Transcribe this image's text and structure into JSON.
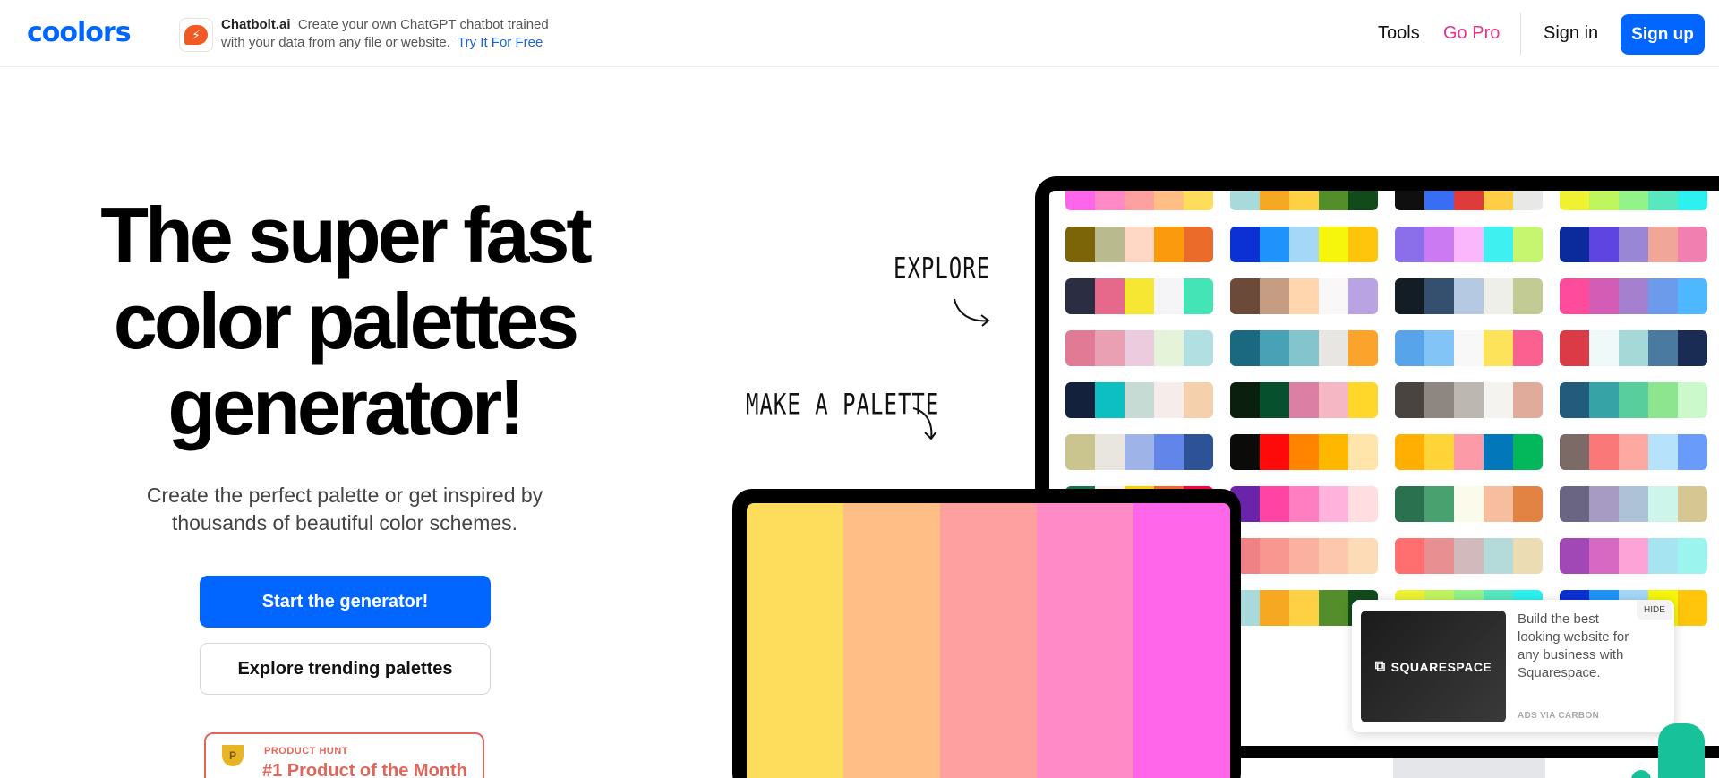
{
  "header": {
    "logo": "coolors",
    "ad": {
      "brand": "Chatbolt.ai",
      "line1": "Create your own ChatGPT chatbot trained",
      "line2": "with your data from any file or website.",
      "cta": "Try It For Free",
      "icon": "chat-bubble-icon"
    },
    "nav": {
      "tools": "Tools",
      "go_pro": "Go Pro",
      "sign_in": "Sign in",
      "sign_up": "Sign up"
    }
  },
  "hero": {
    "title_line1": "The super fast",
    "title_line2": "color palettes",
    "title_line3": "generator!",
    "subtitle_line1": "Create the perfect palette or get inspired by",
    "subtitle_line2": "thousands of beautiful color schemes.",
    "primary_button": "Start the generator!",
    "secondary_button": "Explore trending palettes",
    "badge_label": "PRODUCT HUNT",
    "badge_title": "#1 Product of the Month",
    "badge_icon": "trophy-icon"
  },
  "labels": {
    "explore": "EXPLORE",
    "make_palette": "MAKE A PALETTE"
  },
  "carbon_ad": {
    "image_text": "SQUARESPACE",
    "text": "Build the best looking website for any business with Squarespace.",
    "via": "ADS VIA CARBON",
    "hide": "HIDE"
  },
  "colors": {
    "accent": "#0066ff",
    "go_pro": "#e6348a",
    "badge": "#e0655a"
  },
  "small_palette": [
    "#ffdd5c",
    "#ffbe85",
    "#ffa0a0",
    "#ff8ac6",
    "#ff66ea"
  ],
  "palettes": [
    [
      "#ff66ea",
      "#ff8ac6",
      "#ffa0a0",
      "#ffbe85",
      "#ffdd5c"
    ],
    [
      "#a8dadc",
      "#f7a823",
      "#fed144",
      "#538e2b",
      "#114b1c"
    ],
    [
      "#0f0f0f",
      "#3a6cf4",
      "#e03b3b",
      "#ffce44",
      "#e8e8e6"
    ],
    [
      "#eff233",
      "#c1f55d",
      "#93f28a",
      "#57e8bf",
      "#2cf1ee"
    ],
    [
      "#7b6508",
      "#b9bb8e",
      "#fed8c5",
      "#fc9a0e",
      "#ea6b2a"
    ],
    [
      "#0b31d4",
      "#1f93fb",
      "#a5d8f7",
      "#f6f60c",
      "#ffc50d"
    ],
    [
      "#8a6eea",
      "#cb7af2",
      "#fbb7fb",
      "#3ef0f0",
      "#c6f56f"
    ],
    [
      "#0b2a9c",
      "#5e44e0",
      "#9987d6",
      "#f0a79a",
      "#f17fb0"
    ],
    [
      "#2b2d42",
      "#e6698c",
      "#f6e733",
      "#f5f5f7",
      "#43e4b6"
    ],
    [
      "#6b4a3a",
      "#c49d82",
      "#ffd6ad",
      "#f9f7f7",
      "#b9a3e3"
    ],
    [
      "#121d25",
      "#34506e",
      "#b6c9e2",
      "#edefe8",
      "#c1cb93"
    ],
    [
      "#fe4b9b",
      "#d35db4",
      "#a580cf",
      "#6c9bec",
      "#4db7ff"
    ],
    [
      "#e07a95",
      "#e9a0b2",
      "#eccbde",
      "#e5f3d8",
      "#b1dfe2"
    ],
    [
      "#1b6981",
      "#48a2b5",
      "#84c4cd",
      "#e8e6e3",
      "#fca32c"
    ],
    [
      "#58a4ea",
      "#82c4f5",
      "#f8f8f8",
      "#fde35a",
      "#fb6190"
    ],
    [
      "#da3b47",
      "#effaf8",
      "#a4d9d8",
      "#4b7aa1",
      "#1b2c54"
    ],
    [
      "#14213d",
      "#0ebfc1",
      "#c5dbd4",
      "#f6ece9",
      "#f4d0ad"
    ],
    [
      "#0a1f0e",
      "#07502e",
      "#db7fa4",
      "#f6b7c4",
      "#ffd62a"
    ],
    [
      "#4a4440",
      "#8e8680",
      "#bdb7b2",
      "#f4f3f0",
      "#e0ab9b"
    ],
    [
      "#225b7c",
      "#36a3a6",
      "#57ce9b",
      "#8ee58f",
      "#ccf9cc"
    ],
    [
      "#cac48f",
      "#e8e6df",
      "#9eb3e8",
      "#6285e9",
      "#2d5297"
    ],
    [
      "#0b0b09",
      "#ff0a0a",
      "#ff8400",
      "#ffb700",
      "#ffe5a9"
    ],
    [
      "#ffae02",
      "#ffd439",
      "#fc9aa8",
      "#0277b9",
      "#02b85a"
    ],
    [
      "#7b6a66",
      "#fa7877",
      "#fda8a0",
      "#b6e3fb",
      "#699cfa"
    ],
    [
      "#117148",
      "#fbf1ea",
      "#ffcc00",
      "#f26629",
      "#ff003c"
    ],
    [
      "#6a24a9",
      "#ff44a3",
      "#ff7dc1",
      "#ffb3dc",
      "#ffdde1"
    ],
    [
      "#2a7150",
      "#4aa170",
      "#fafbeb",
      "#f6bd9e",
      "#e28344"
    ],
    [
      "#6a6583",
      "#a89bc3",
      "#adc1d7",
      "#cef5ea",
      "#d6c792"
    ],
    [
      "#677282",
      "#8a9aaa",
      "#d6c9b5",
      "#e9b467",
      "#a47247"
    ],
    [
      "#ef8284",
      "#f7978f",
      "#fab19f",
      "#fcc7ac",
      "#fddbb6"
    ],
    [
      "#ff6f6f",
      "#e88f92",
      "#d2b9bb",
      "#b4dbd9",
      "#ecdcb4"
    ],
    [
      "#a147b6",
      "#d768c4",
      "#fda3d7",
      "#a5e4f0",
      "#9bf5ee"
    ],
    [
      "#8c76f0",
      "#b5aaf2",
      "#ddddef",
      "#f7e4d8",
      "#fcd3ae"
    ],
    [
      "#a8dadc",
      "#f7a823",
      "#fed144",
      "#538e2b",
      "#114b1c"
    ],
    [
      "#eff233",
      "#c1f55d",
      "#93f28a",
      "#57e8bf",
      "#2cf1ee"
    ],
    [
      "#0b31d4",
      "#1f93fb",
      "#a5d8f7",
      "#f6f60c",
      "#ffc50d"
    ]
  ]
}
